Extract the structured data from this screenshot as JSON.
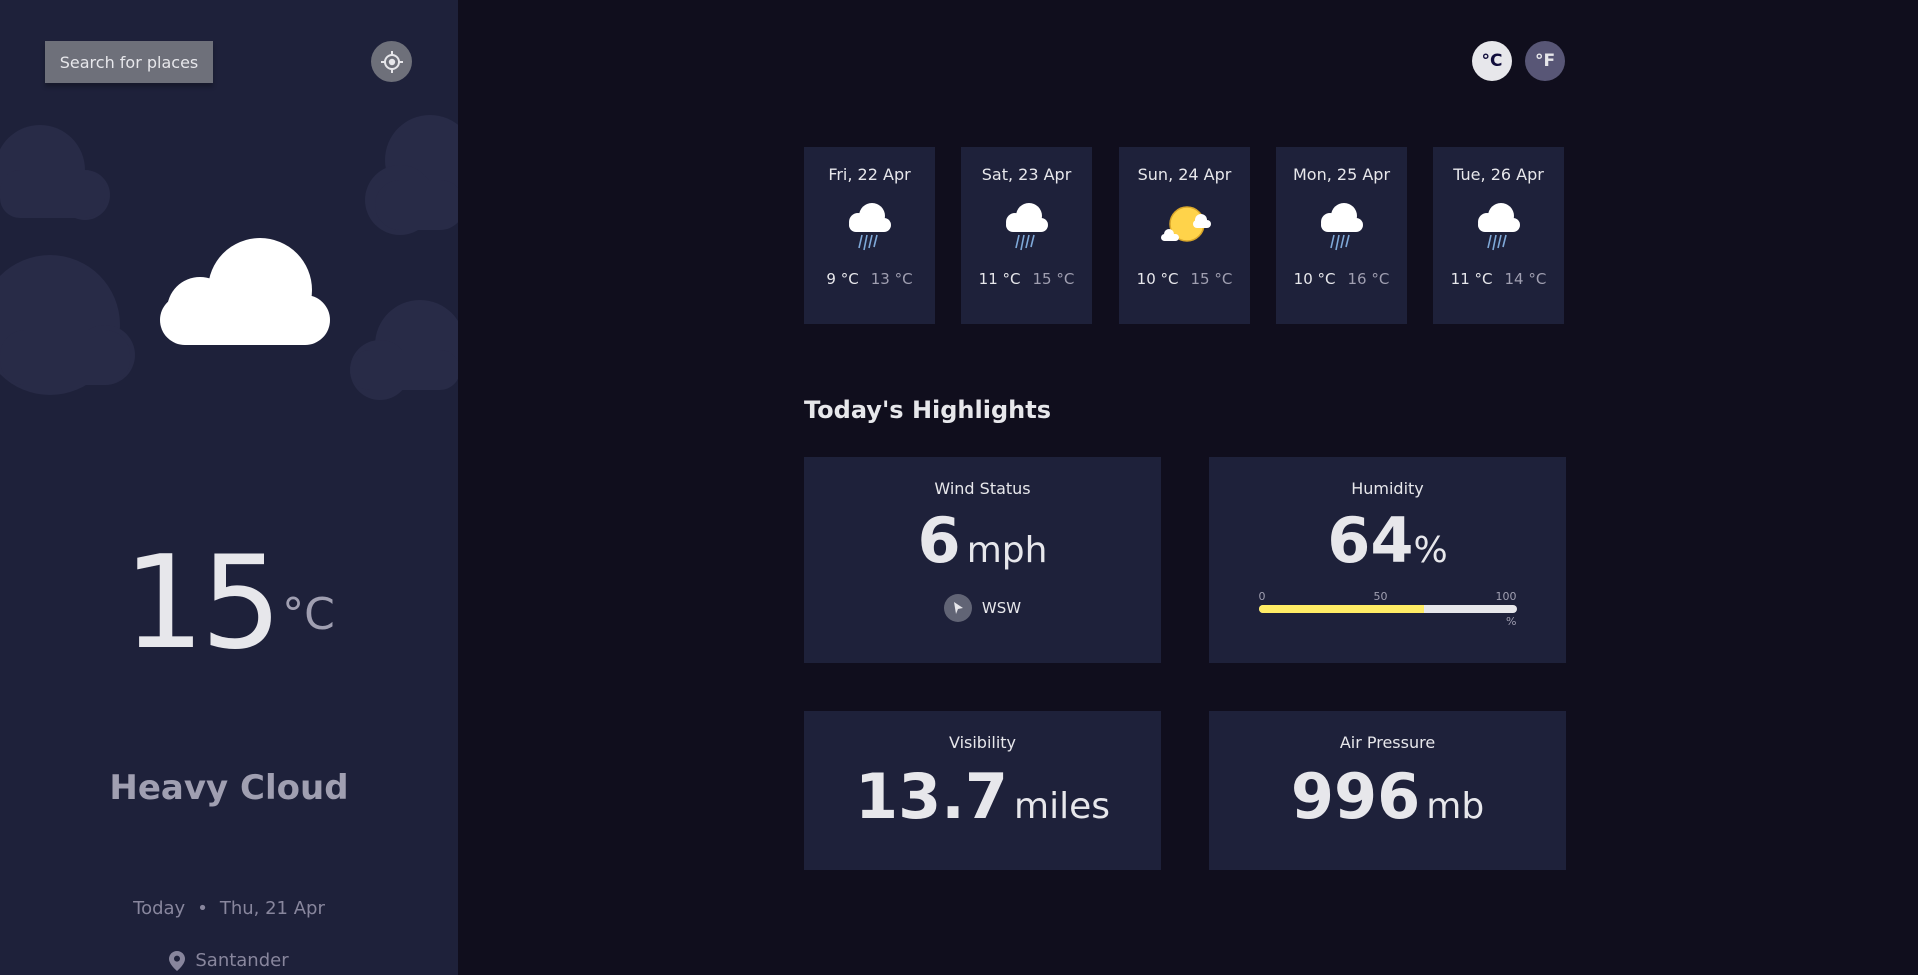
{
  "search": {
    "label": "Search for places"
  },
  "current": {
    "temp": "15",
    "unit": "°C",
    "condition": "Heavy Cloud",
    "today_label": "Today",
    "separator": "•",
    "date": "Thu, 21 Apr",
    "location": "Santander",
    "icon": "heavy-cloud-icon"
  },
  "units": {
    "celsius": "°C",
    "fahrenheit": "°F"
  },
  "forecast": [
    {
      "date": "Fri, 22 Apr",
      "max": "9 °C",
      "min": "13 °C",
      "icon": "light-rain-icon"
    },
    {
      "date": "Sat, 23 Apr",
      "max": "11 °C",
      "min": "15 °C",
      "icon": "light-rain-icon"
    },
    {
      "date": "Sun, 24 Apr",
      "max": "10 °C",
      "min": "15 °C",
      "icon": "light-cloud-icon"
    },
    {
      "date": "Mon, 25 Apr",
      "max": "10 °C",
      "min": "16 °C",
      "icon": "light-rain-icon"
    },
    {
      "date": "Tue, 26 Apr",
      "max": "11 °C",
      "min": "14 °C",
      "icon": "light-rain-icon"
    }
  ],
  "highlights": {
    "title": "Today's Highlights",
    "wind": {
      "label": "Wind Status",
      "value": "6",
      "unit": "mph",
      "direction": "WSW"
    },
    "humidity": {
      "label": "Humidity",
      "value": "64",
      "unit": "%",
      "scale": [
        "0",
        "50",
        "100"
      ],
      "scale_unit": "%",
      "fraction": 0.64
    },
    "visibility": {
      "label": "Visibility",
      "value": "13.7",
      "unit": "miles"
    },
    "pressure": {
      "label": "Air Pressure",
      "value": "996",
      "unit": "mb"
    }
  },
  "colors": {
    "sidebar": "#1e213a",
    "background": "#100e1d",
    "accent": "#ffec65"
  }
}
